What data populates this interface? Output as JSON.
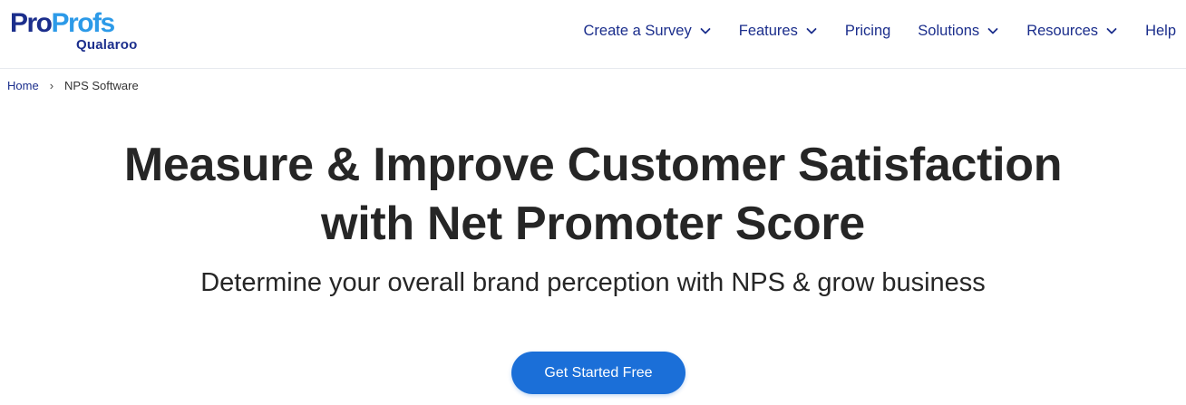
{
  "brand": {
    "logo_pro": "Pro",
    "logo_profs": "Profs",
    "logo_sub": "Qualaroo",
    "colors": {
      "navy": "#1b2e8c",
      "sky": "#2c9ae8",
      "cta": "#1b6fd8"
    }
  },
  "nav": {
    "items": [
      {
        "label": "Create a Survey",
        "has_dropdown": true
      },
      {
        "label": "Features",
        "has_dropdown": true
      },
      {
        "label": "Pricing",
        "has_dropdown": false
      },
      {
        "label": "Solutions",
        "has_dropdown": true
      },
      {
        "label": "Resources",
        "has_dropdown": true
      },
      {
        "label": "Help",
        "has_dropdown": false
      }
    ],
    "dropdown_icon": "chevron-down-icon"
  },
  "breadcrumb": {
    "home": "Home",
    "separator": "›",
    "current": "NPS Software"
  },
  "hero": {
    "title_line1": "Measure & Improve Customer Satisfaction",
    "title_line2": "with Net Promoter Score",
    "subtitle": "Determine your overall brand perception with NPS & grow business"
  },
  "cta": {
    "label": "Get Started Free"
  }
}
